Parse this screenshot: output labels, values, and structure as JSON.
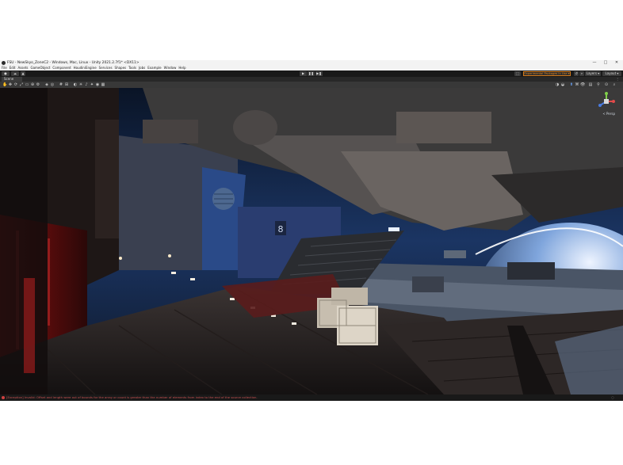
{
  "window": {
    "title": "FSU - NewSkyo_ZoneC2 - Windows, Mac, Linux - Unity 2021.2.7f1* <DX11>",
    "controls": {
      "minimize": "—",
      "maximize": "□",
      "close": "✕"
    }
  },
  "menubar": {
    "items": [
      "File",
      "Edit",
      "Assets",
      "GameObject",
      "Component",
      "HoudiniEngine",
      "Services",
      "Shapes",
      "Tools",
      "Jobs",
      "Example",
      "Window",
      "Help"
    ]
  },
  "toolbar": {
    "play": "▶",
    "pause": "❚❚",
    "step": "▶❚",
    "experimental_badge": "Experimental Packages In Use ▾",
    "layers_label": "Layers ▾",
    "layout_label": "Layout ▾"
  },
  "scene_tab": {
    "label": "Scene"
  },
  "gizmo": {
    "projection_label": "< Persp"
  },
  "viewport": {
    "sign_text": "8"
  },
  "status": {
    "message": "[Exception] Invalid: Offset and length were out of bounds for the array or count is greater than the number of elements from index to the end of the source collection."
  },
  "colors": {
    "accent_orange": "#d47a1a",
    "error_red": "#c85050",
    "editor_dark": "#191919"
  }
}
